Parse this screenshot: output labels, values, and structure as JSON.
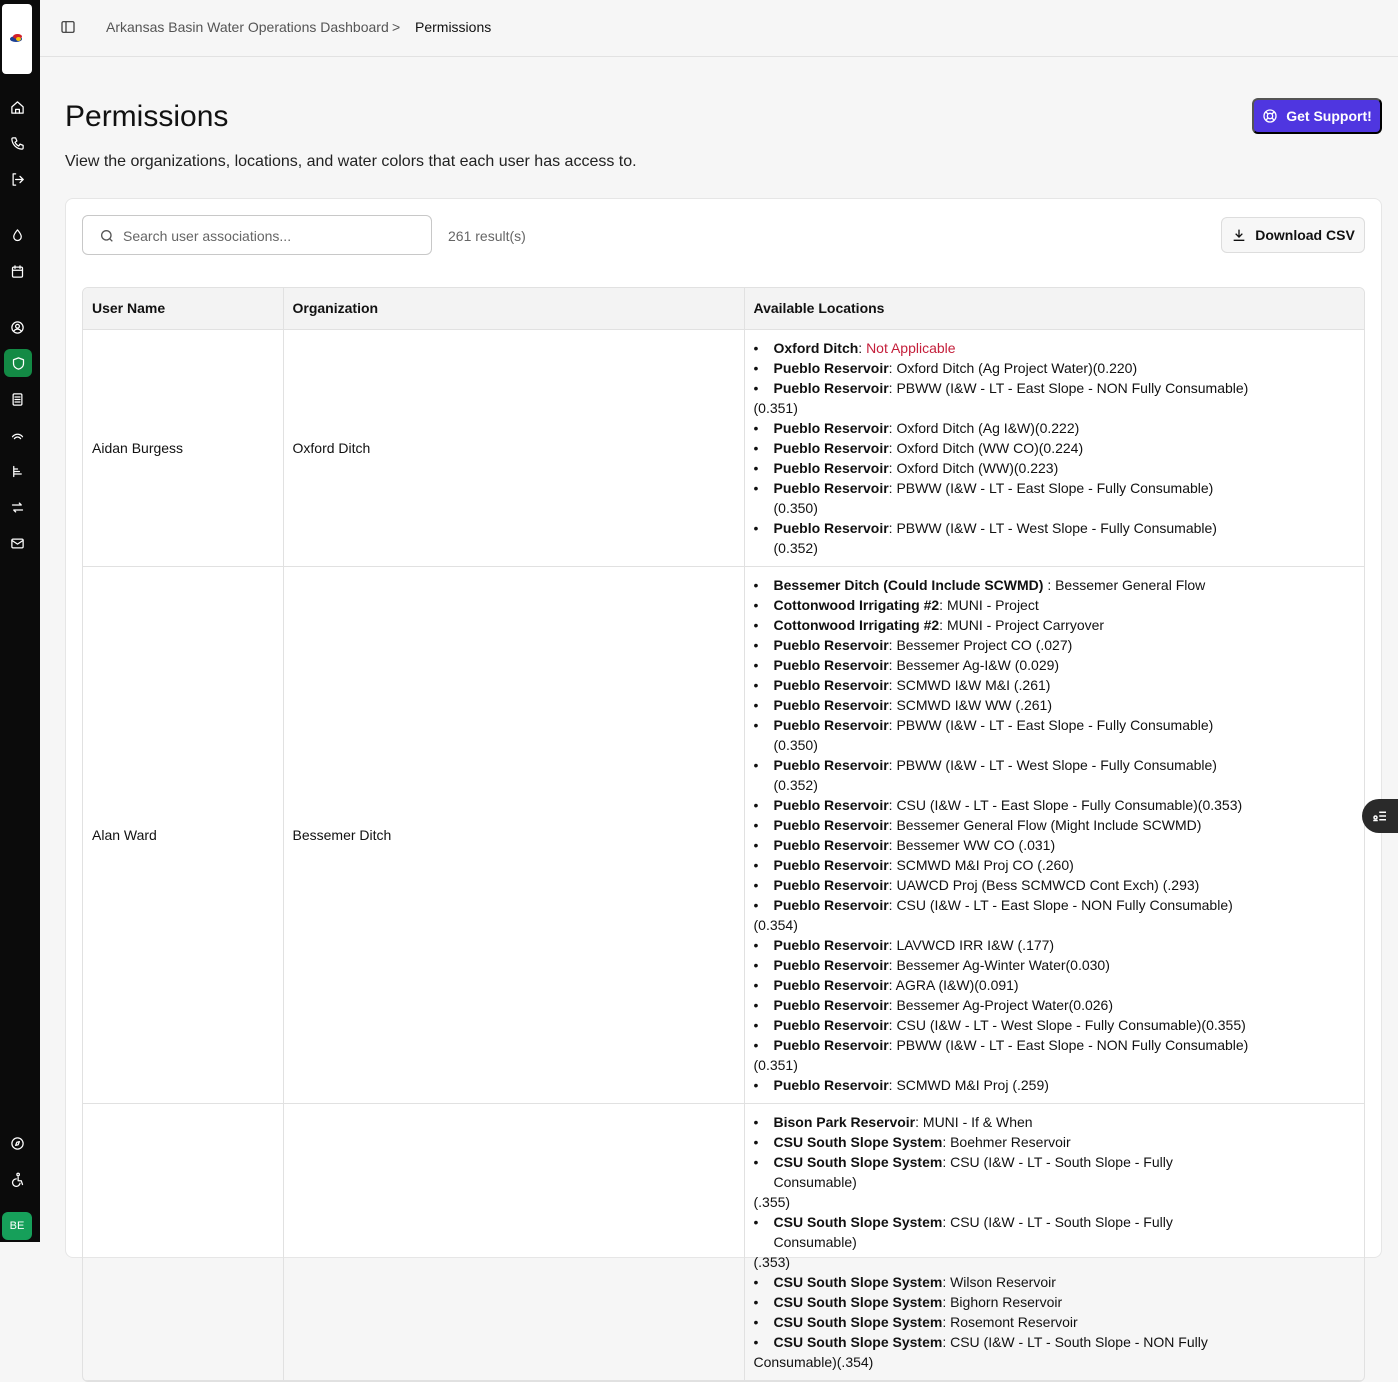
{
  "app": {
    "avatar_initials": "BE"
  },
  "breadcrumb": {
    "root": "Arkansas Basin Water Operations Dashboard",
    "separator": ">",
    "current": "Permissions"
  },
  "page": {
    "title": "Permissions",
    "subtitle": "View the organizations, locations, and water colors that each user has access to.",
    "support_label": "Get Support!"
  },
  "toolbar": {
    "search_placeholder": "Search user associations...",
    "result_count": "261 result(s)",
    "download_label": "Download CSV"
  },
  "table": {
    "headers": {
      "user": "User Name",
      "org": "Organization",
      "locations": "Available Locations"
    },
    "rows": [
      {
        "user": "Aidan Burgess",
        "org": "Oxford Ditch",
        "locations": [
          {
            "loc": "Oxford Ditch",
            "sep": ": ",
            "color": "Not Applicable",
            "na": true
          },
          {
            "loc": "Pueblo Reservoir",
            "sep": ": ",
            "color": "Oxford Ditch (Ag Project Water)(0.220)"
          },
          {
            "loc": "Pueblo Reservoir",
            "sep": ": ",
            "color": "PBWW (I&W - LT - East Slope - NON Fully Consumable)",
            "tail": "(0.351)"
          },
          {
            "loc": "Pueblo Reservoir",
            "sep": ": ",
            "color": "Oxford Ditch (Ag I&W)(0.222)"
          },
          {
            "loc": "Pueblo Reservoir",
            "sep": ": ",
            "color": "Oxford Ditch (WW CO)(0.224)"
          },
          {
            "loc": "Pueblo Reservoir",
            "sep": ": ",
            "color": "Oxford Ditch (WW)(0.223)"
          },
          {
            "loc": "Pueblo Reservoir",
            "sep": ": ",
            "color": "PBWW (I&W - LT - East Slope - Fully Consumable)(0.350)"
          },
          {
            "loc": "Pueblo Reservoir",
            "sep": ": ",
            "color": "PBWW (I&W - LT - West Slope - Fully Consumable)(0.352)"
          }
        ]
      },
      {
        "user": "Alan Ward",
        "org": "Bessemer Ditch",
        "locations": [
          {
            "loc": "Bessemer Ditch (Could Include SCWMD) ",
            "sep": ": ",
            "color": "Bessemer General Flow"
          },
          {
            "loc": "Cottonwood Irrigating #2",
            "sep": ": ",
            "color": "MUNI - Project"
          },
          {
            "loc": "Cottonwood Irrigating #2",
            "sep": ": ",
            "color": "MUNI - Project Carryover"
          },
          {
            "loc": "Pueblo Reservoir",
            "sep": ": ",
            "color": "Bessemer Project CO (.027)"
          },
          {
            "loc": "Pueblo Reservoir",
            "sep": ": ",
            "color": "Bessemer Ag-I&W (0.029)"
          },
          {
            "loc": "Pueblo Reservoir",
            "sep": ": ",
            "color": "SCMWD I&W M&I (.261)"
          },
          {
            "loc": "Pueblo Reservoir",
            "sep": ": ",
            "color": "SCMWD I&W WW (.261)"
          },
          {
            "loc": "Pueblo Reservoir",
            "sep": ": ",
            "color": "PBWW (I&W - LT - East Slope - Fully Consumable)(0.350)"
          },
          {
            "loc": "Pueblo Reservoir",
            "sep": ": ",
            "color": "PBWW (I&W - LT - West Slope - Fully Consumable)(0.352)"
          },
          {
            "loc": "Pueblo Reservoir",
            "sep": ": ",
            "color": "CSU (I&W - LT - East Slope - Fully Consumable)(0.353)"
          },
          {
            "loc": "Pueblo Reservoir",
            "sep": ": ",
            "color": "Bessemer General Flow (Might Include SCWMD)"
          },
          {
            "loc": "Pueblo Reservoir",
            "sep": ": ",
            "color": "Bessemer WW CO (.031)"
          },
          {
            "loc": "Pueblo Reservoir",
            "sep": ": ",
            "color": "SCMWD M&I Proj CO (.260)"
          },
          {
            "loc": "Pueblo Reservoir",
            "sep": ": ",
            "color": "UAWCD Proj (Bess SCMWCD Cont Exch) (.293)"
          },
          {
            "loc": "Pueblo Reservoir",
            "sep": ": ",
            "color": "CSU (I&W - LT - East Slope - NON Fully Consumable)",
            "tail": "(0.354)"
          },
          {
            "loc": "Pueblo Reservoir",
            "sep": ": ",
            "color": "LAVWCD IRR I&W (.177)"
          },
          {
            "loc": "Pueblo Reservoir",
            "sep": ": ",
            "color": "Bessemer Ag-Winter Water(0.030)"
          },
          {
            "loc": "Pueblo Reservoir",
            "sep": ": ",
            "color": "AGRA (I&W)(0.091)"
          },
          {
            "loc": "Pueblo Reservoir",
            "sep": ": ",
            "color": "Bessemer Ag-Project Water(0.026)"
          },
          {
            "loc": "Pueblo Reservoir",
            "sep": ": ",
            "color": "CSU (I&W - LT - West Slope - Fully Consumable)(0.355)"
          },
          {
            "loc": "Pueblo Reservoir",
            "sep": ": ",
            "color": "PBWW (I&W - LT - East Slope - NON Fully Consumable)",
            "tail": "(0.351)"
          },
          {
            "loc": "Pueblo Reservoir",
            "sep": ": ",
            "color": "SCMWD M&I Proj (.259)"
          }
        ]
      },
      {
        "user": "",
        "org": "",
        "locations": [
          {
            "loc": "Bison Park Reservoir",
            "sep": ": ",
            "color": "MUNI - If & When"
          },
          {
            "loc": "CSU South Slope System",
            "sep": ": ",
            "color": "Boehmer Reservoir"
          },
          {
            "loc": "CSU South Slope System",
            "sep": ": ",
            "color": "CSU (I&W - LT - South Slope - Fully Consumable)",
            "tail": "(.355)"
          },
          {
            "loc": "CSU South Slope System",
            "sep": ": ",
            "color": "CSU (I&W - LT - South Slope - Fully Consumable)",
            "tail": "(.353)"
          },
          {
            "loc": "CSU South Slope System",
            "sep": ": ",
            "color": "Wilson Reservoir"
          },
          {
            "loc": "CSU South Slope System",
            "sep": ": ",
            "color": "Bighorn Reservoir"
          },
          {
            "loc": "CSU South Slope System",
            "sep": ": ",
            "color": "Rosemont Reservoir"
          },
          {
            "loc": "CSU South Slope System",
            "sep": ": ",
            "color": "CSU (I&W - LT - South Slope - NON Fully",
            "tail": "Consumable)(.354)"
          }
        ]
      }
    ]
  }
}
